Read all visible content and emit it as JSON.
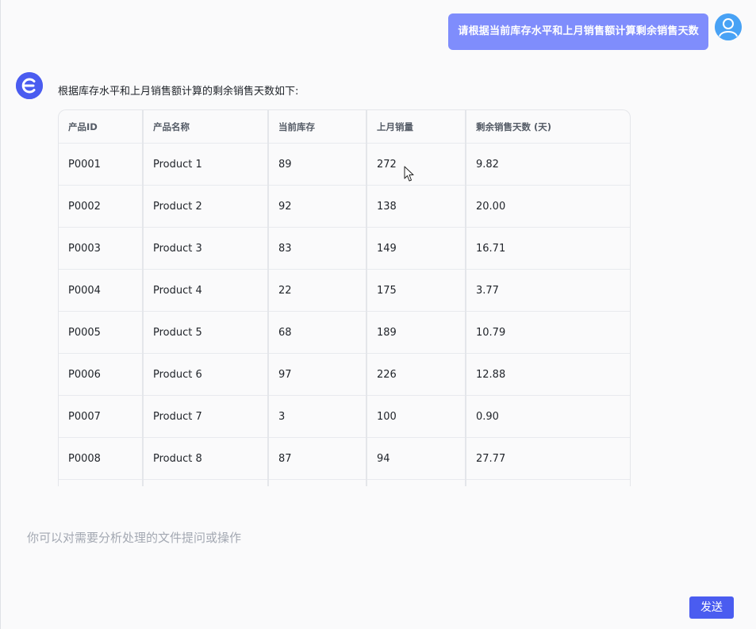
{
  "user_message": {
    "text": "请根据当前库存水平和上月销售额计算剩余销售天数",
    "avatar_icon": "user-avatar-icon"
  },
  "bot_message": {
    "avatar_icon": "app-logo-icon",
    "intro": "根据库存水平和上月销售额计算的剩余销售天数如下:"
  },
  "table": {
    "headers": [
      "产品ID",
      "产品名称",
      "当前库存",
      "上月销量",
      "剩余销售天数 (天)"
    ],
    "rows": [
      [
        "P0001",
        "Product 1",
        "89",
        "272",
        "9.82"
      ],
      [
        "P0002",
        "Product 2",
        "92",
        "138",
        "20.00"
      ],
      [
        "P0003",
        "Product 3",
        "83",
        "149",
        "16.71"
      ],
      [
        "P0004",
        "Product 4",
        "22",
        "175",
        "3.77"
      ],
      [
        "P0005",
        "Product 5",
        "68",
        "189",
        "10.79"
      ],
      [
        "P0006",
        "Product 6",
        "97",
        "226",
        "12.88"
      ],
      [
        "P0007",
        "Product 7",
        "3",
        "100",
        "0.90"
      ],
      [
        "P0008",
        "Product 8",
        "87",
        "94",
        "27.77"
      ],
      [
        "",
        "",
        "",
        "",
        ""
      ]
    ]
  },
  "composer": {
    "placeholder": "你可以对需要分析处理的文件提问或操作",
    "send_label": "发送"
  },
  "colors": {
    "accent": "#4a5cf0",
    "user_bubble": "#7f8dfc",
    "user_avatar": "#48a2f5"
  }
}
